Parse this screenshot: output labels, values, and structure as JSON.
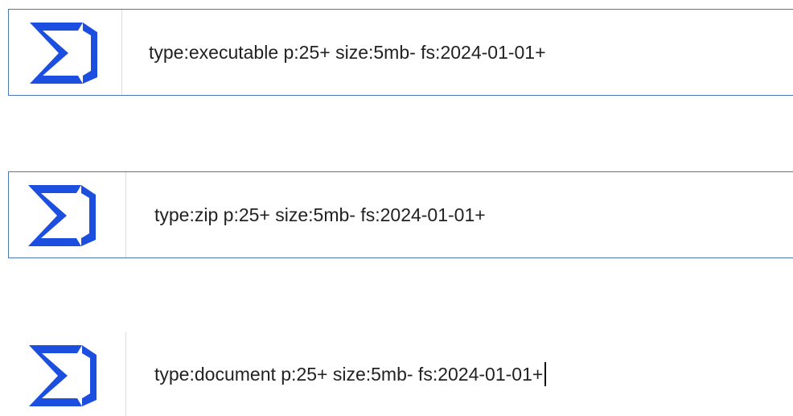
{
  "icons": {
    "logo": "sigma-icon"
  },
  "colors": {
    "logo_blue": "#1c4fe0",
    "border": "#4a78b5"
  },
  "searches": [
    {
      "query": "type:executable p:25+ size:5mb- fs:2024-01-01+"
    },
    {
      "query": "type:zip p:25+ size:5mb- fs:2024-01-01+"
    },
    {
      "query": "type:document p:25+ size:5mb- fs:2024-01-01+"
    }
  ]
}
